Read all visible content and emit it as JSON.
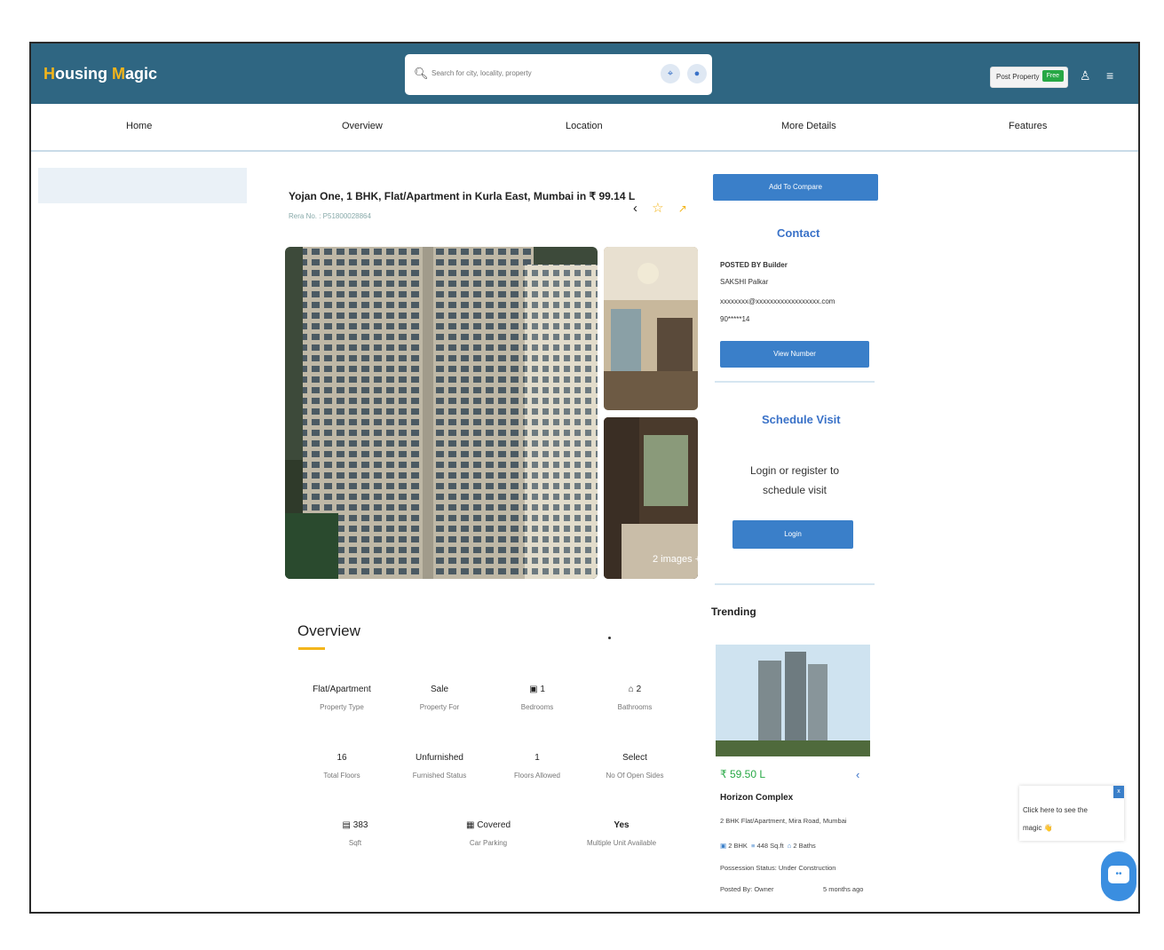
{
  "app": {
    "logo_h": "H",
    "logo_rest_1": "ousing ",
    "logo_m": "M",
    "logo_rest_2": "agic"
  },
  "search": {
    "placeholder": "Search for city, locality, property"
  },
  "header": {
    "post_property_label": "Post Property",
    "free_badge": "Free"
  },
  "nav": {
    "items": [
      {
        "label": "Home"
      },
      {
        "label": "Overview"
      },
      {
        "label": "Location"
      },
      {
        "label": "More Details"
      },
      {
        "label": "Features"
      }
    ]
  },
  "listing": {
    "title": "Yojan One, 1 BHK, Flat/Apartment in Kurla East, Mumbai in ₹ 99.14 L",
    "rera_id": "Rera No. : P51800028864",
    "images_count": "2 images +"
  },
  "overview": {
    "heading": "Overview",
    "rows": [
      [
        {
          "value": "Flat/Apartment",
          "label": "Property Type"
        },
        {
          "value": "Sale",
          "label": "Property For"
        },
        {
          "value": "1",
          "label": "Bedrooms",
          "icon": "bed-icon"
        },
        {
          "value": "2",
          "label": "Bathrooms",
          "icon": "bath-icon"
        }
      ],
      [
        {
          "value": "16",
          "label": "Total Floors"
        },
        {
          "value": "Unfurnished",
          "label": "Furnished Status"
        },
        {
          "value": "1",
          "label": "Floors Allowed"
        },
        {
          "value": "Select",
          "label": "No Of Open Sides"
        }
      ],
      [
        {
          "value": "383",
          "label": "Sqft",
          "icon": "area-icon"
        },
        {
          "value": "Covered",
          "label": "Car Parking",
          "icon": "parking-icon"
        },
        {
          "value": "Yes",
          "label": "Multiple Unit Available"
        }
      ]
    ]
  },
  "sidebar": {
    "compare_label": "Add To Compare",
    "contact_heading": "Contact",
    "posted_by": "POSTED BY Builder",
    "contact_name": "SAKSHI Palkar",
    "contact_email": "xxxxxxxx@xxxxxxxxxxxxxxxxxx.com",
    "contact_phone": "90*****14",
    "view_number_label": "View Number",
    "schedule_heading": "Schedule Visit",
    "schedule_text": "Login or register to schedule visit",
    "login_label": "Login",
    "trending_heading": "Trending"
  },
  "trending": {
    "price": "₹ 59.50 L",
    "name": "Horizon Complex",
    "subtitle": "2 BHK Flat/Apartment, Mira Road, Mumbai",
    "beds": "2 BHK",
    "area": "448 Sq.ft",
    "baths": "2 Baths",
    "possession": "Possession Status: Under Construction",
    "posted_by": "Posted By: Owner",
    "posted_when": "5 months ago"
  },
  "chat": {
    "prompt_line1": "Click here to see the",
    "prompt_line2": "magic 👋",
    "close": "x"
  },
  "colors": {
    "topbar": "#2f6682",
    "accent": "#3a7fc9",
    "logo_accent": "#f3b51b",
    "price_green": "#27a845"
  }
}
